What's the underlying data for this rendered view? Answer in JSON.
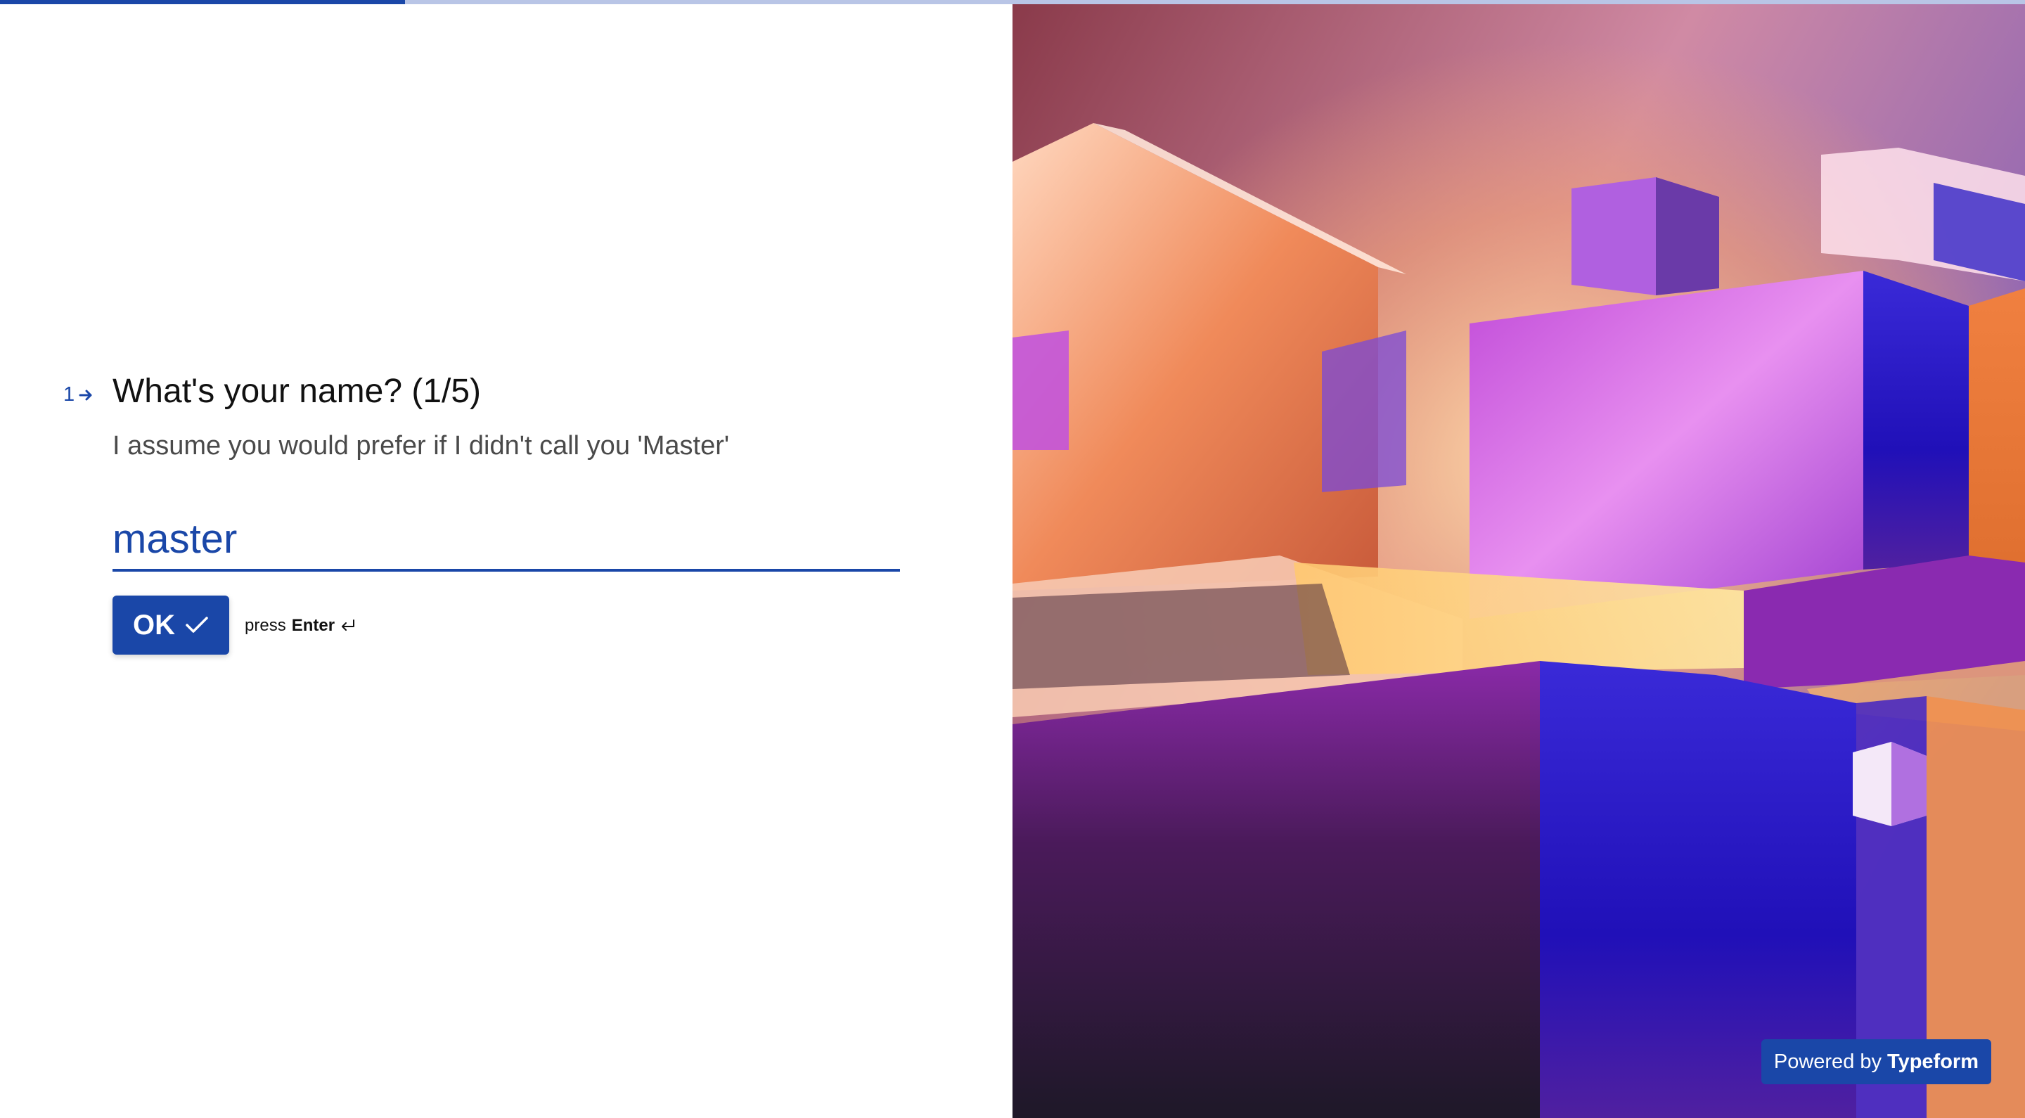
{
  "progress": {
    "fraction": 0.2
  },
  "question": {
    "number": "1",
    "title": "What's your name? (1/5)",
    "description": "I assume you would prefer if I didn't call you 'Master'",
    "answer_value": "master"
  },
  "actions": {
    "ok_label": "OK",
    "hint_prefix": "press",
    "hint_key": "Enter"
  },
  "footer": {
    "powered_by_prefix": "Powered by",
    "powered_by_brand": "Typeform"
  },
  "colors": {
    "accent": "#1a47a8",
    "progress_track": "#b9c5e6"
  },
  "icons": {
    "question_arrow": "arrow-right-icon",
    "ok_check": "check-icon",
    "enter": "enter-key-icon",
    "nav_up": "chevron-up-icon",
    "nav_down": "chevron-down-icon"
  }
}
